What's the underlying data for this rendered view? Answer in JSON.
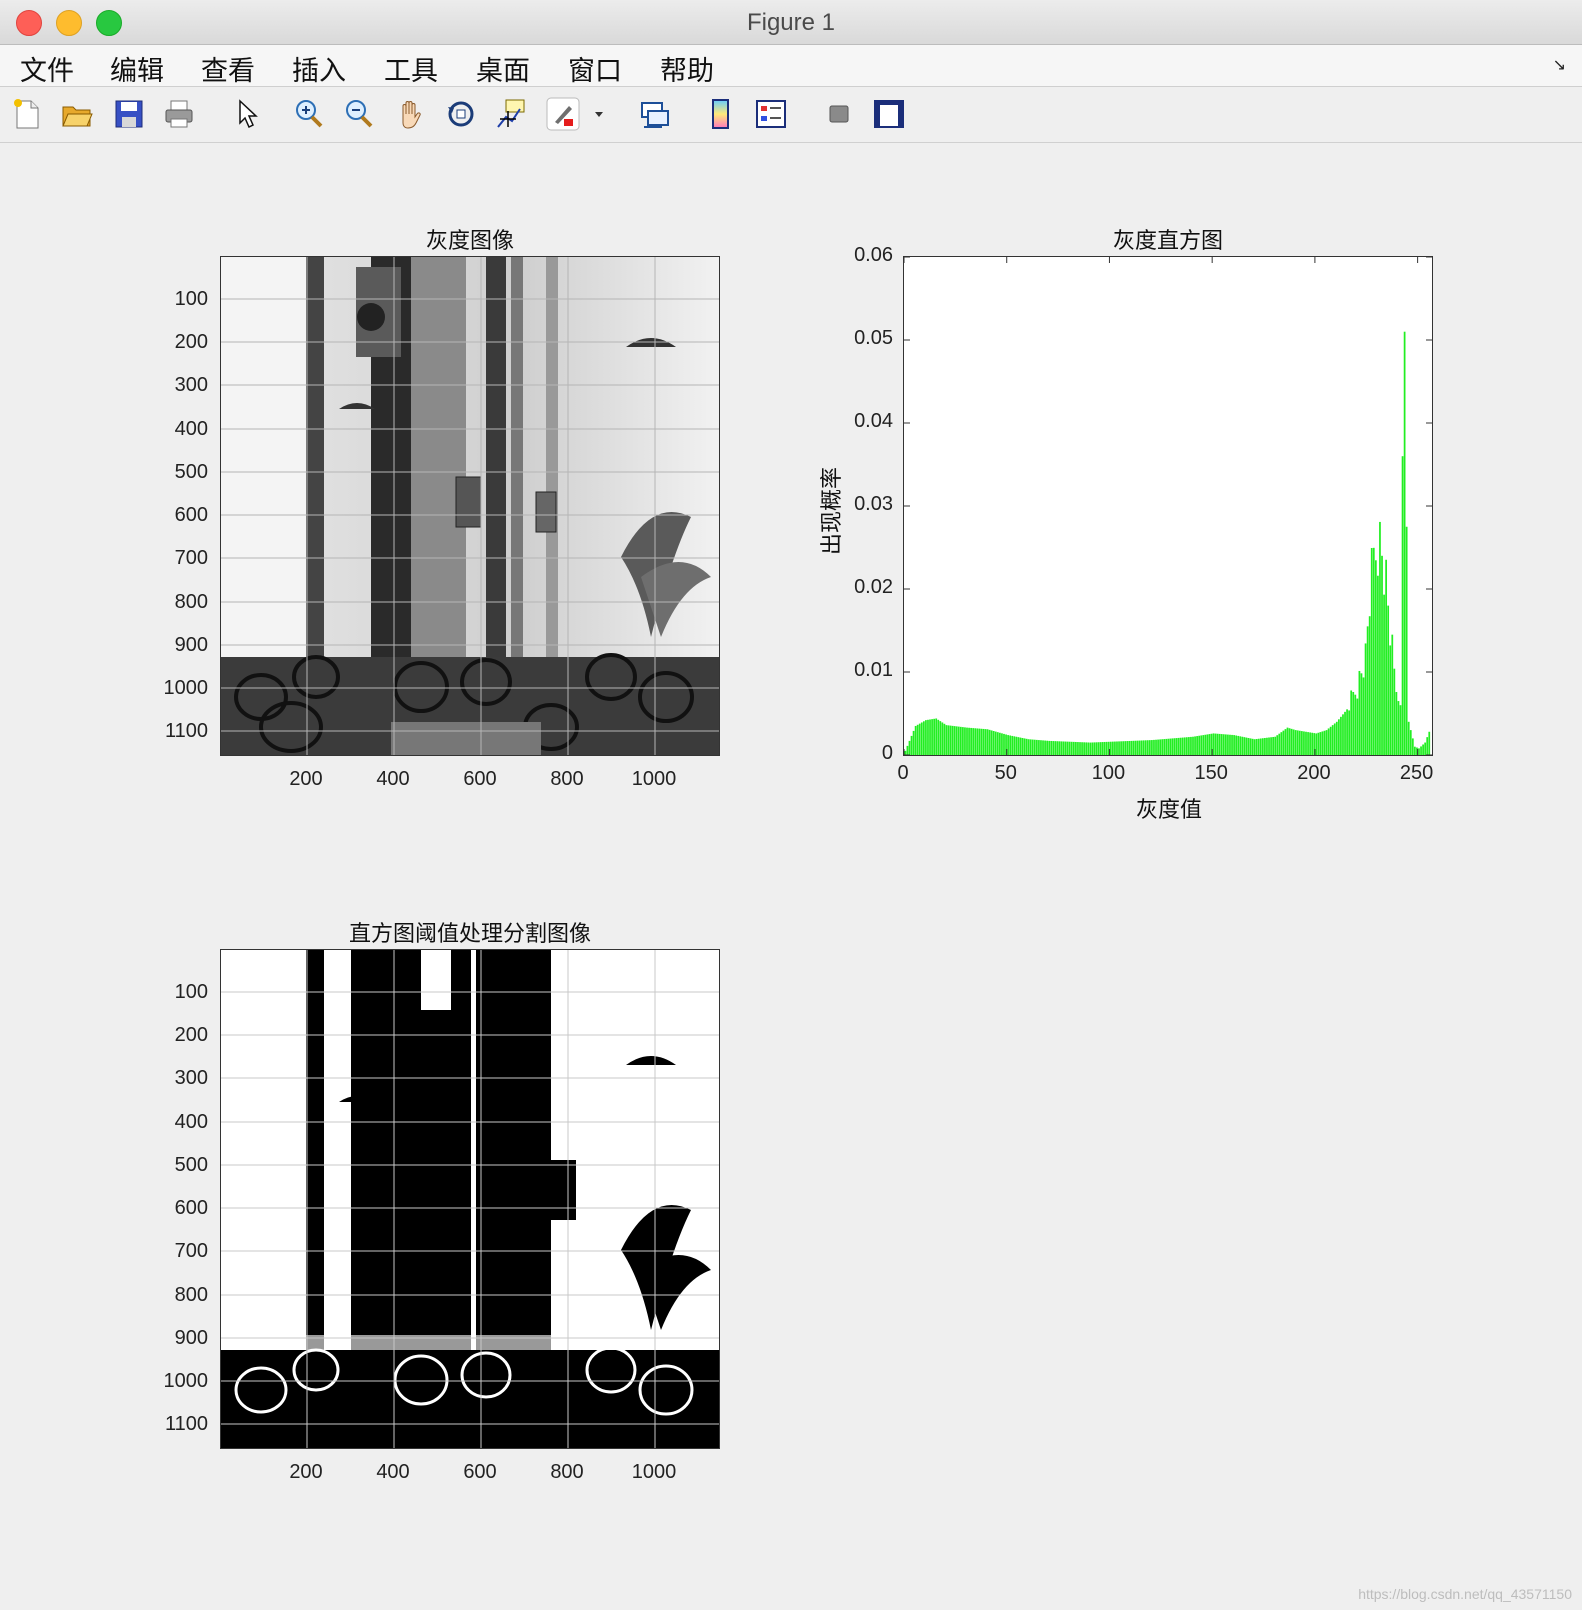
{
  "window": {
    "title": "Figure 1"
  },
  "menu": [
    "文件",
    "编辑",
    "查看",
    "插入",
    "工具",
    "桌面",
    "窗口",
    "帮助"
  ],
  "menu_corner": "↘",
  "toolbar": [
    "new-figure-icon",
    "open-folder-icon",
    "save-icon",
    "print-icon",
    "pointer-icon",
    "zoom-in-icon",
    "zoom-out-icon",
    "pan-hand-icon",
    "rotate-3d-icon",
    "data-cursor-icon",
    "brush-icon",
    "brush-dropdown-icon",
    "link-plot-icon",
    "colorbar-icon",
    "legend-icon",
    "hide-plot-tools-icon",
    "show-plot-tools-icon"
  ],
  "panels": {
    "gray_image": {
      "title": "灰度图像",
      "yticks": [
        "100",
        "200",
        "300",
        "400",
        "500",
        "600",
        "700",
        "800",
        "900",
        "1000",
        "1100"
      ],
      "xticks": [
        "200",
        "400",
        "600",
        "800",
        "1000"
      ]
    },
    "threshold_image": {
      "title": "直方图阈值处理分割图像",
      "yticks": [
        "100",
        "200",
        "300",
        "400",
        "500",
        "600",
        "700",
        "800",
        "900",
        "1000",
        "1100"
      ],
      "xticks": [
        "200",
        "400",
        "600",
        "800",
        "1000"
      ]
    }
  },
  "chart_data": {
    "type": "bar",
    "title": "灰度直方图",
    "xlabel": "灰度值",
    "ylabel": "出现概率",
    "xlim": [
      0,
      257
    ],
    "ylim": [
      0,
      0.06
    ],
    "xticks": [
      "0",
      "50",
      "100",
      "150",
      "200",
      "250"
    ],
    "yticks": [
      "0",
      "0.01",
      "0.02",
      "0.03",
      "0.04",
      "0.05",
      "0.06"
    ],
    "color": "#22ee22",
    "x": [
      0,
      5,
      10,
      15,
      20,
      30,
      40,
      50,
      60,
      70,
      80,
      90,
      100,
      110,
      120,
      130,
      140,
      150,
      160,
      170,
      180,
      186,
      190,
      200,
      205,
      210,
      215,
      220,
      224,
      226,
      228,
      230,
      232,
      234,
      236,
      238,
      240,
      241,
      242,
      243,
      245,
      248,
      250,
      253,
      255
    ],
    "values": [
      0.0005,
      0.0035,
      0.0042,
      0.0044,
      0.0036,
      0.0033,
      0.0031,
      0.0024,
      0.0019,
      0.0017,
      0.0016,
      0.0015,
      0.0016,
      0.0017,
      0.0018,
      0.002,
      0.0022,
      0.0026,
      0.0024,
      0.0019,
      0.0022,
      0.0033,
      0.003,
      0.0026,
      0.003,
      0.004,
      0.0055,
      0.0085,
      0.012,
      0.019,
      0.024,
      0.027,
      0.025,
      0.021,
      0.015,
      0.01,
      0.0065,
      0.006,
      0.036,
      0.051,
      0.004,
      0.001,
      0.0008,
      0.0015,
      0.0028
    ]
  },
  "watermark": "https://blog.csdn.net/qq_43571150"
}
